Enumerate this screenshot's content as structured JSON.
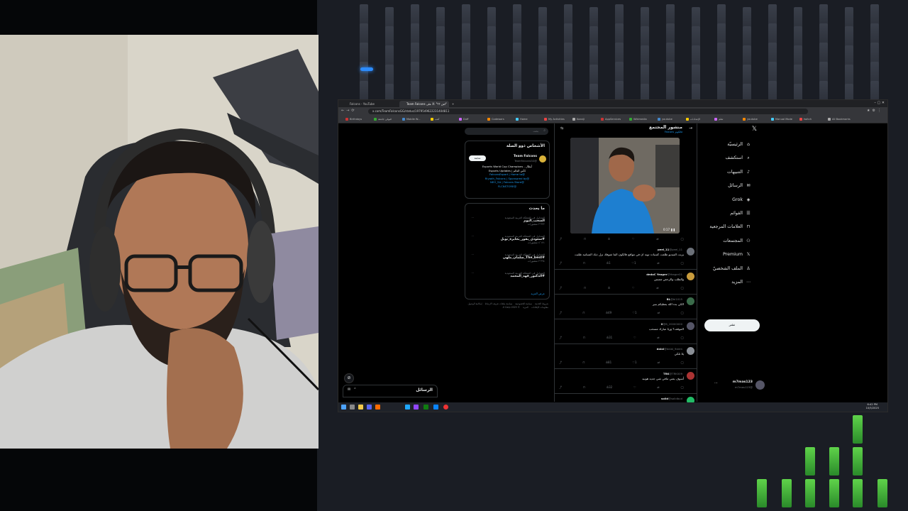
{
  "browser": {
    "tabs": [
      {
        "title": "Falcons - YouTube"
      },
      {
        "title": "Team Falcons على X: \"اش ؟؟\""
      }
    ],
    "url": "x.com/TeamFalconsGG/status/1979549622231404811",
    "bookmarks": [
      "Birthdays",
      "قبولي جامعة",
      "Mobile W...",
      "كتب",
      "Duff",
      "Codewars",
      "Home",
      "My Activities",
      "Kaanji",
      "AppServices",
      "Wikimedia",
      "youtube",
      "الإعدادات",
      "تعلم",
      "youtube",
      "Manual Mode",
      "twitch",
      "All Bookmarks"
    ]
  },
  "nav": {
    "items": [
      {
        "label": "الرئيسيّة",
        "icon": "home-icon"
      },
      {
        "label": "استكشف",
        "icon": "search-icon"
      },
      {
        "label": "التنبيهات",
        "icon": "bell-icon"
      },
      {
        "label": "الرسائل",
        "icon": "mail-icon"
      },
      {
        "label": "Grok",
        "icon": "grok-icon"
      },
      {
        "label": "القوائم",
        "icon": "list-icon"
      },
      {
        "label": "العلامات المرجعية",
        "icon": "bookmark-icon"
      },
      {
        "label": "المجتمعات",
        "icon": "people-icon"
      },
      {
        "label": "Premium",
        "icon": "x-logo-icon"
      },
      {
        "label": "الملف الشخصيّ",
        "icon": "person-icon"
      },
      {
        "label": "المزيد",
        "icon": "more-icon"
      }
    ],
    "post_button": "نشر",
    "account": {
      "name": "m7mas123",
      "handle": "@m7mas123"
    }
  },
  "post": {
    "header_title": "منشور المجتمع",
    "header_sub": "فالكونز Falcons",
    "video_time": "0:17"
  },
  "replies": [
    {
      "name": "peel_11",
      "handle": "@peel_11",
      "text": "يرنت الفيديو طلعت كسبات توبه ان في مواقع فالكون الما شوفك نزل ذيك التسانيه طلبت",
      "likes": "1",
      "views": "1"
    },
    {
      "name": "dedaC Yeager",
      "handle": "@Yeager01",
      "text": "والطلب والرحص متتبس",
      "likes": "",
      "views": ""
    },
    {
      "name": "BL",
      "handle": "@bl1015",
      "text": "الكي بدء الله يعطيكم بنير",
      "likes": "1",
      "views": "49"
    },
    {
      "name": "X",
      "handle": "@8_20000000",
      "text": "الموقف؟ ورثا مبارك مسحب",
      "likes": "",
      "views": "31"
    },
    {
      "name": "dalal",
      "handle": "@dalaI_9aren",
      "text": "يلا تلكي",
      "likes": "1",
      "views": "81"
    },
    {
      "name": "TRK",
      "handle": "@TRK009",
      "text": "أسوف يعني مافي شي جديد هونيد",
      "likes": "",
      "views": "32"
    },
    {
      "name": "solid",
      "handle": "@solidbud",
      "text": "",
      "likes": "",
      "views": ""
    }
  ],
  "sidebar": {
    "search_placeholder": "بحث",
    "related_title": "الأشخاص ذوو الصلة",
    "profile": {
      "name": "Team Falcons",
      "handle": "@TeamFalconsGG",
      "follow": "متابعة",
      "bio": [
        "أبطال - Esports World Cup Champions",
        "كأس العالم | Esports Updates",
        "@FalconsEsport | Home to",
        "@Riyadh_Falcons | Sponsored by",
        "@NEO_SA | Falcons Store",
        "@FLCNSTORE"
      ]
    },
    "happening_title": "ما يحدث",
    "trends": [
      {
        "meta": "المتداول في المملكة العربية السعودية",
        "topic": "السحب_اليوم",
        "count": "٢٬٣٣٢ منشورات"
      },
      {
        "meta": "المتداول في المملكة العربية السعودية",
        "topic": "#سعودي_يفوز_بجايزة_نوبل",
        "count": "٤٬١٧١ منشورات"
      },
      {
        "meta": "المتداول في المملكة العربية السعودية",
        "topic": "#The_best_سلمان_ملهي",
        "count": "٢٬٣٩٤ منشورات"
      },
      {
        "meta": "المتداول في المملكة العربية السعودية",
        "topic": "#الدكتور_فهد_المحمد",
        "count": ""
      }
    ],
    "show_more": "عرض المزيد",
    "footer": [
      "شروط الخدمة",
      "سياسة الخصوصية",
      "سياسة ملفات تعريف الارتباط",
      "إمكانية الوصول",
      "معلومات الإعلانات",
      "المزيد",
      "© 2025 X Corp."
    ]
  },
  "dm": {
    "title": "الرسائل"
  },
  "taskbar": {
    "time": "6:42 PM",
    "date": "10/5/2025"
  }
}
